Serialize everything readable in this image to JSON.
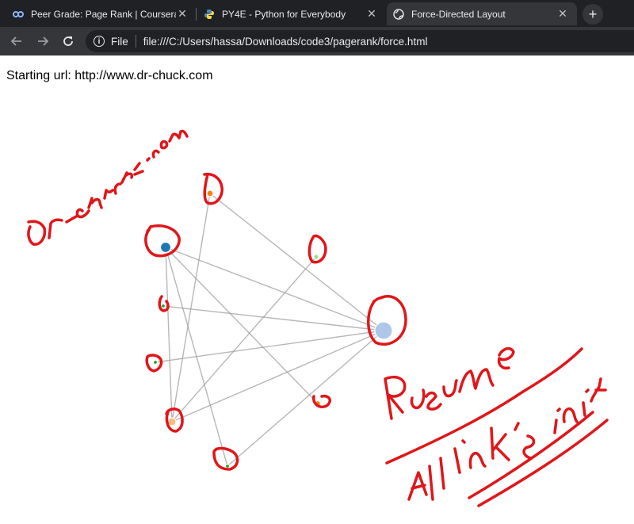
{
  "tabs": [
    {
      "title": "Peer Grade: Page Rank | Coursera",
      "icon": "coursera-icon",
      "active": false
    },
    {
      "title": "PY4E - Python for Everybody",
      "icon": "python-icon",
      "active": false
    },
    {
      "title": "Force-Directed Layout",
      "icon": "globe-icon",
      "active": true
    }
  ],
  "toolbar": {
    "scheme_label": "File",
    "url": "file:///C:/Users/hassa/Downloads/code3/pagerank/force.html"
  },
  "page": {
    "starting_url": "Starting url: http://www.dr-chuck.com"
  },
  "graph": {
    "nodes": [
      {
        "id": "hub",
        "color": "#aec7e8"
      },
      {
        "id": "n-blue",
        "color": "#1f77b4"
      },
      {
        "id": "n-orange-top",
        "color": "#ff7f0e"
      },
      {
        "id": "n-green-right",
        "color": "#98df8a"
      },
      {
        "id": "n-green-left",
        "color": "#2ca02c"
      },
      {
        "id": "n-green-mid",
        "color": "#2ca02c"
      },
      {
        "id": "n-peach",
        "color": "#ffbb78"
      },
      {
        "id": "n-orange-right",
        "color": "#ff7f0e"
      },
      {
        "id": "n-green-bottom",
        "color": "#2ca02c"
      }
    ],
    "link_color": "#999999"
  },
  "annotations": {
    "pen_color": "#e0161a",
    "texts": [
      "Dr-chuck.com",
      "Rusume",
      "All link's init"
    ]
  }
}
